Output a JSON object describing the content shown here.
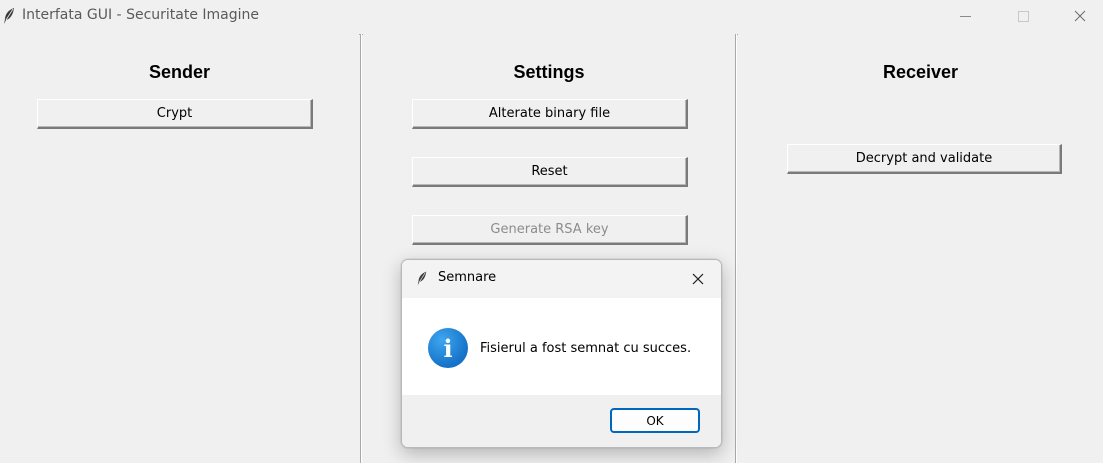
{
  "window": {
    "title": "Interfata GUI - Securitate Imagine",
    "controls": {
      "minimize_icon": "minimize-icon",
      "maximize_icon": "maximize-icon",
      "close_icon": "close-icon"
    }
  },
  "sender": {
    "title": "Sender",
    "crypt_button": "Crypt"
  },
  "settings": {
    "title": "Settings",
    "alterate_button": "Alterate binary file",
    "reset_button": "Reset",
    "generate_rsa_button": "Generate RSA key"
  },
  "receiver": {
    "title": "Receiver",
    "decrypt_button": "Decrypt and validate"
  },
  "dialog": {
    "title": "Semnare",
    "message": "Fisierul a fost semnat cu succes.",
    "ok_button": "OK",
    "info_icon_glyph": "i"
  },
  "colors": {
    "background": "#f0f0f0",
    "dialog_accent": "#0067c0",
    "info_icon": "#1572c8"
  }
}
